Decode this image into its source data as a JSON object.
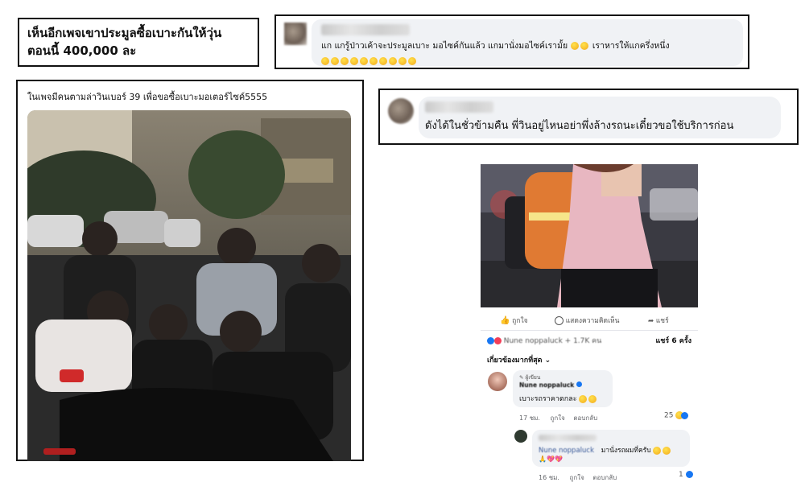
{
  "headline": {
    "line1": "เห็นอีกเพจเขาประมูลซื้อเบาะกันให้วุ่น",
    "line2": "ตอนนี้ 400,000 ละ"
  },
  "comment1": {
    "text": "แก แกรู้ป่าวเค้าจะประมูลเบาะ มอไซค์กันแล้ว แกมานั่งมอไซค์เรามั้ย",
    "text2": "เราหารให้แกครึ่งหนึ่ง"
  },
  "photo_post": {
    "caption": "ในเพจมีคนตามล่าวินเบอร์ 39 เพื่อขอซื้อเบาะมอเตอร์ไซค์5555"
  },
  "comment2": {
    "text": "ดังได้ในชั่วข้ามคืน พี่วินอยู่ไหนอย่าพึ่งล้างรถนะเดี๋ยวขอใช้บริการก่อน"
  },
  "fb_post": {
    "like_label": "ถูกใจ",
    "comment_label": "แสดงความคิดเห็น",
    "share_label": "แชร์",
    "reactions": "Nune noppaluck + 1.7K คน",
    "shares": "แชร์ 6 ครั้ง",
    "sort_label": "เกี่ยวข้องมากที่สุด",
    "reply1": {
      "badge": "ผู้เขียน",
      "author": "Nune noppaluck",
      "text": "เบาะรถราคาตกละ",
      "time": "17 ชม.",
      "like": "ถูกใจ",
      "reply": "ตอบกลับ",
      "count": "25"
    },
    "reply2": {
      "mention": "Nune noppaluck",
      "text": "มานั่งรถผมที่ครับ",
      "time": "16 ชม.",
      "like": "ถูกใจ",
      "reply": "ตอบกลับ",
      "count": "1"
    }
  },
  "colors": {
    "fb_blue": "#1877f2",
    "reaction_red": "#f33e58",
    "comment_bg": "#f0f2f5"
  }
}
